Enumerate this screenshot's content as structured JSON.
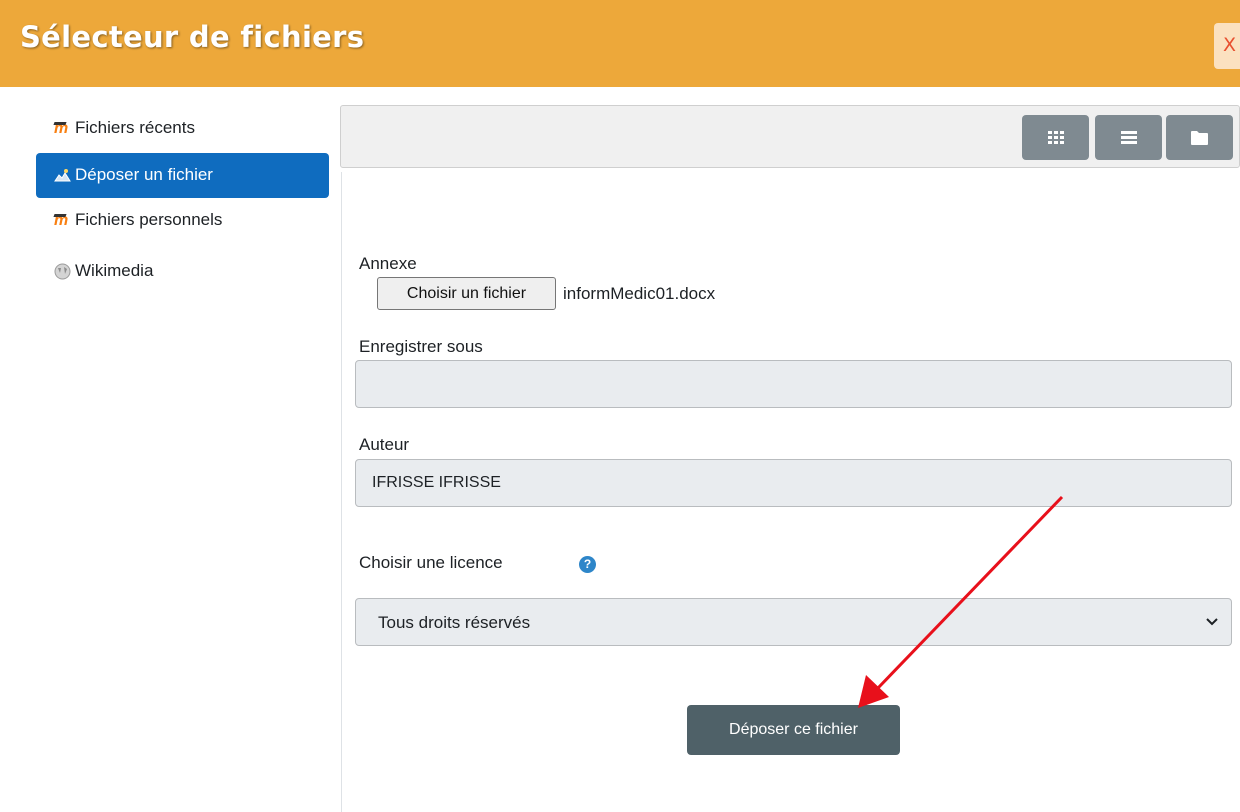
{
  "dialog": {
    "title": "Sélecteur de fichiers",
    "close_label": "X"
  },
  "sidebar": {
    "items": [
      {
        "label": "Fichiers récents",
        "icon": "moodle-icon",
        "active": false
      },
      {
        "label": "Déposer un fichier",
        "icon": "upload-icon",
        "active": true
      },
      {
        "label": "Fichiers personnels",
        "icon": "moodle-icon",
        "active": false
      },
      {
        "label": "Wikimedia",
        "icon": "wikimedia-icon",
        "active": false
      }
    ]
  },
  "toolbar": {
    "buttons": [
      "grid-view-icon",
      "list-view-icon",
      "folder-view-icon"
    ]
  },
  "form": {
    "attachment_label": "Annexe",
    "choose_file_label": "Choisir un fichier",
    "file_name": "informMedic01.docx",
    "save_as_label": "Enregistrer sous",
    "save_as_value": "",
    "author_label": "Auteur",
    "author_value": "IFRISSE IFRISSE",
    "license_label": "Choisir une licence",
    "help_icon": "?",
    "license_value": "Tous droits réservés",
    "submit_label": "Déposer ce fichier"
  },
  "colors": {
    "header": "#eda83a",
    "active_item": "#0f6cbf",
    "toolbar_button": "#7f8a91",
    "submit_button": "#4f6168",
    "annotation_arrow": "#e8101b"
  }
}
